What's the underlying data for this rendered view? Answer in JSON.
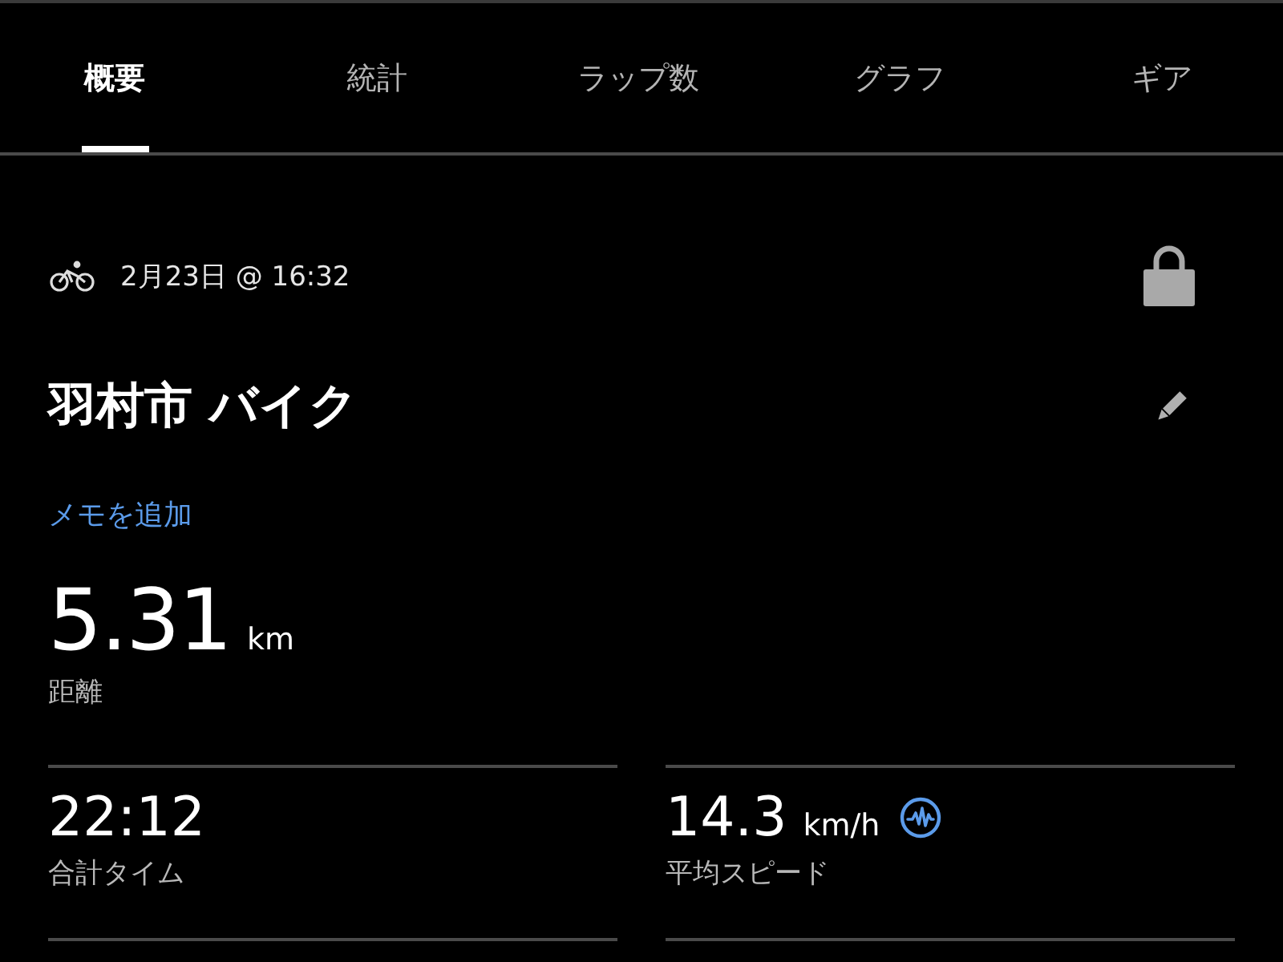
{
  "tabs": [
    {
      "label": "概要",
      "selected": true
    },
    {
      "label": "統計",
      "selected": false
    },
    {
      "label": "ラップ数",
      "selected": false
    },
    {
      "label": "グラフ",
      "selected": false
    },
    {
      "label": "ギア",
      "selected": false
    }
  ],
  "activity": {
    "date": "2月23日 @ 16:32",
    "title": "羽村市 バイク",
    "add_note": "メモを追加"
  },
  "distance": {
    "value": "5.31",
    "unit": "km",
    "label": "距離"
  },
  "stats": [
    {
      "kind": "plain",
      "value": "22:12",
      "label": "合計タイム"
    },
    {
      "kind": "insight",
      "value": "14.3",
      "unit": "km/h",
      "label": "平均スピード"
    }
  ]
}
